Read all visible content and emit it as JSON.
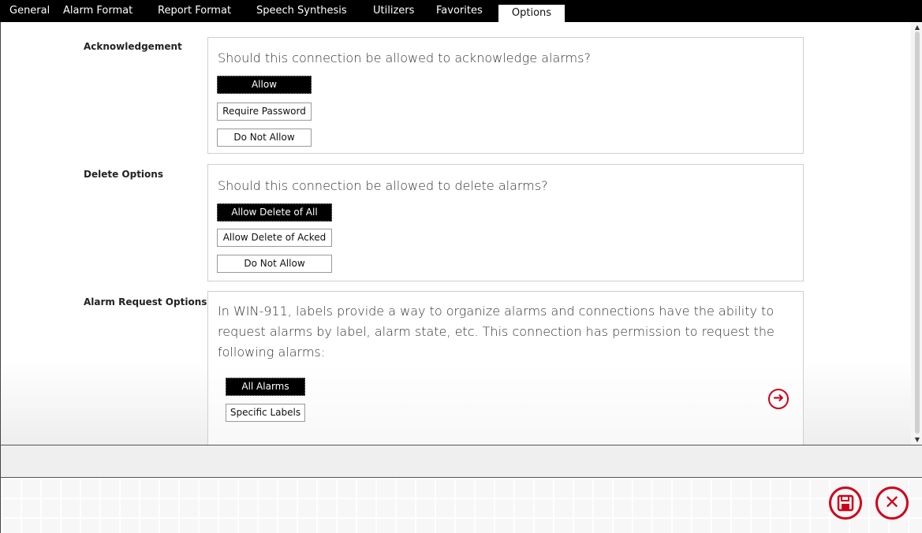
{
  "tabs": [
    {
      "label": "General"
    },
    {
      "label": "Alarm Format"
    },
    {
      "label": "Report Format"
    },
    {
      "label": "Speech Synthesis"
    },
    {
      "label": "Utilizers"
    },
    {
      "label": "Favorites"
    },
    {
      "label": "Options",
      "active": true
    }
  ],
  "acknowledgement": {
    "label": "Acknowledgement",
    "question": "Should this connection be allowed to acknowledge alarms?",
    "options": [
      "Allow",
      "Require Password",
      "Do Not Allow"
    ],
    "selected": "Allow"
  },
  "delete_options": {
    "label": "Delete Options",
    "question": "Should this connection be allowed to delete alarms?",
    "options": [
      "Allow Delete of All",
      "Allow Delete of Acked",
      "Do Not Allow"
    ],
    "selected": "Allow Delete of All"
  },
  "alarm_request_options": {
    "label": "Alarm Request Options",
    "question": "In WIN-911, labels provide a way to organize alarms and connections have the ability to request alarms by label, alarm state, etc. This connection has permission to request the following alarms:",
    "options": [
      "All Alarms",
      "Specific Labels"
    ],
    "selected": "All Alarms",
    "next_icon": "arrow-right-circle-icon"
  },
  "footer": {
    "save_icon": "save-icon",
    "close_icon": "close-icon"
  },
  "colors": {
    "accent": "#d0021b",
    "tabbar": "#000000",
    "selected_option": "#000000"
  }
}
